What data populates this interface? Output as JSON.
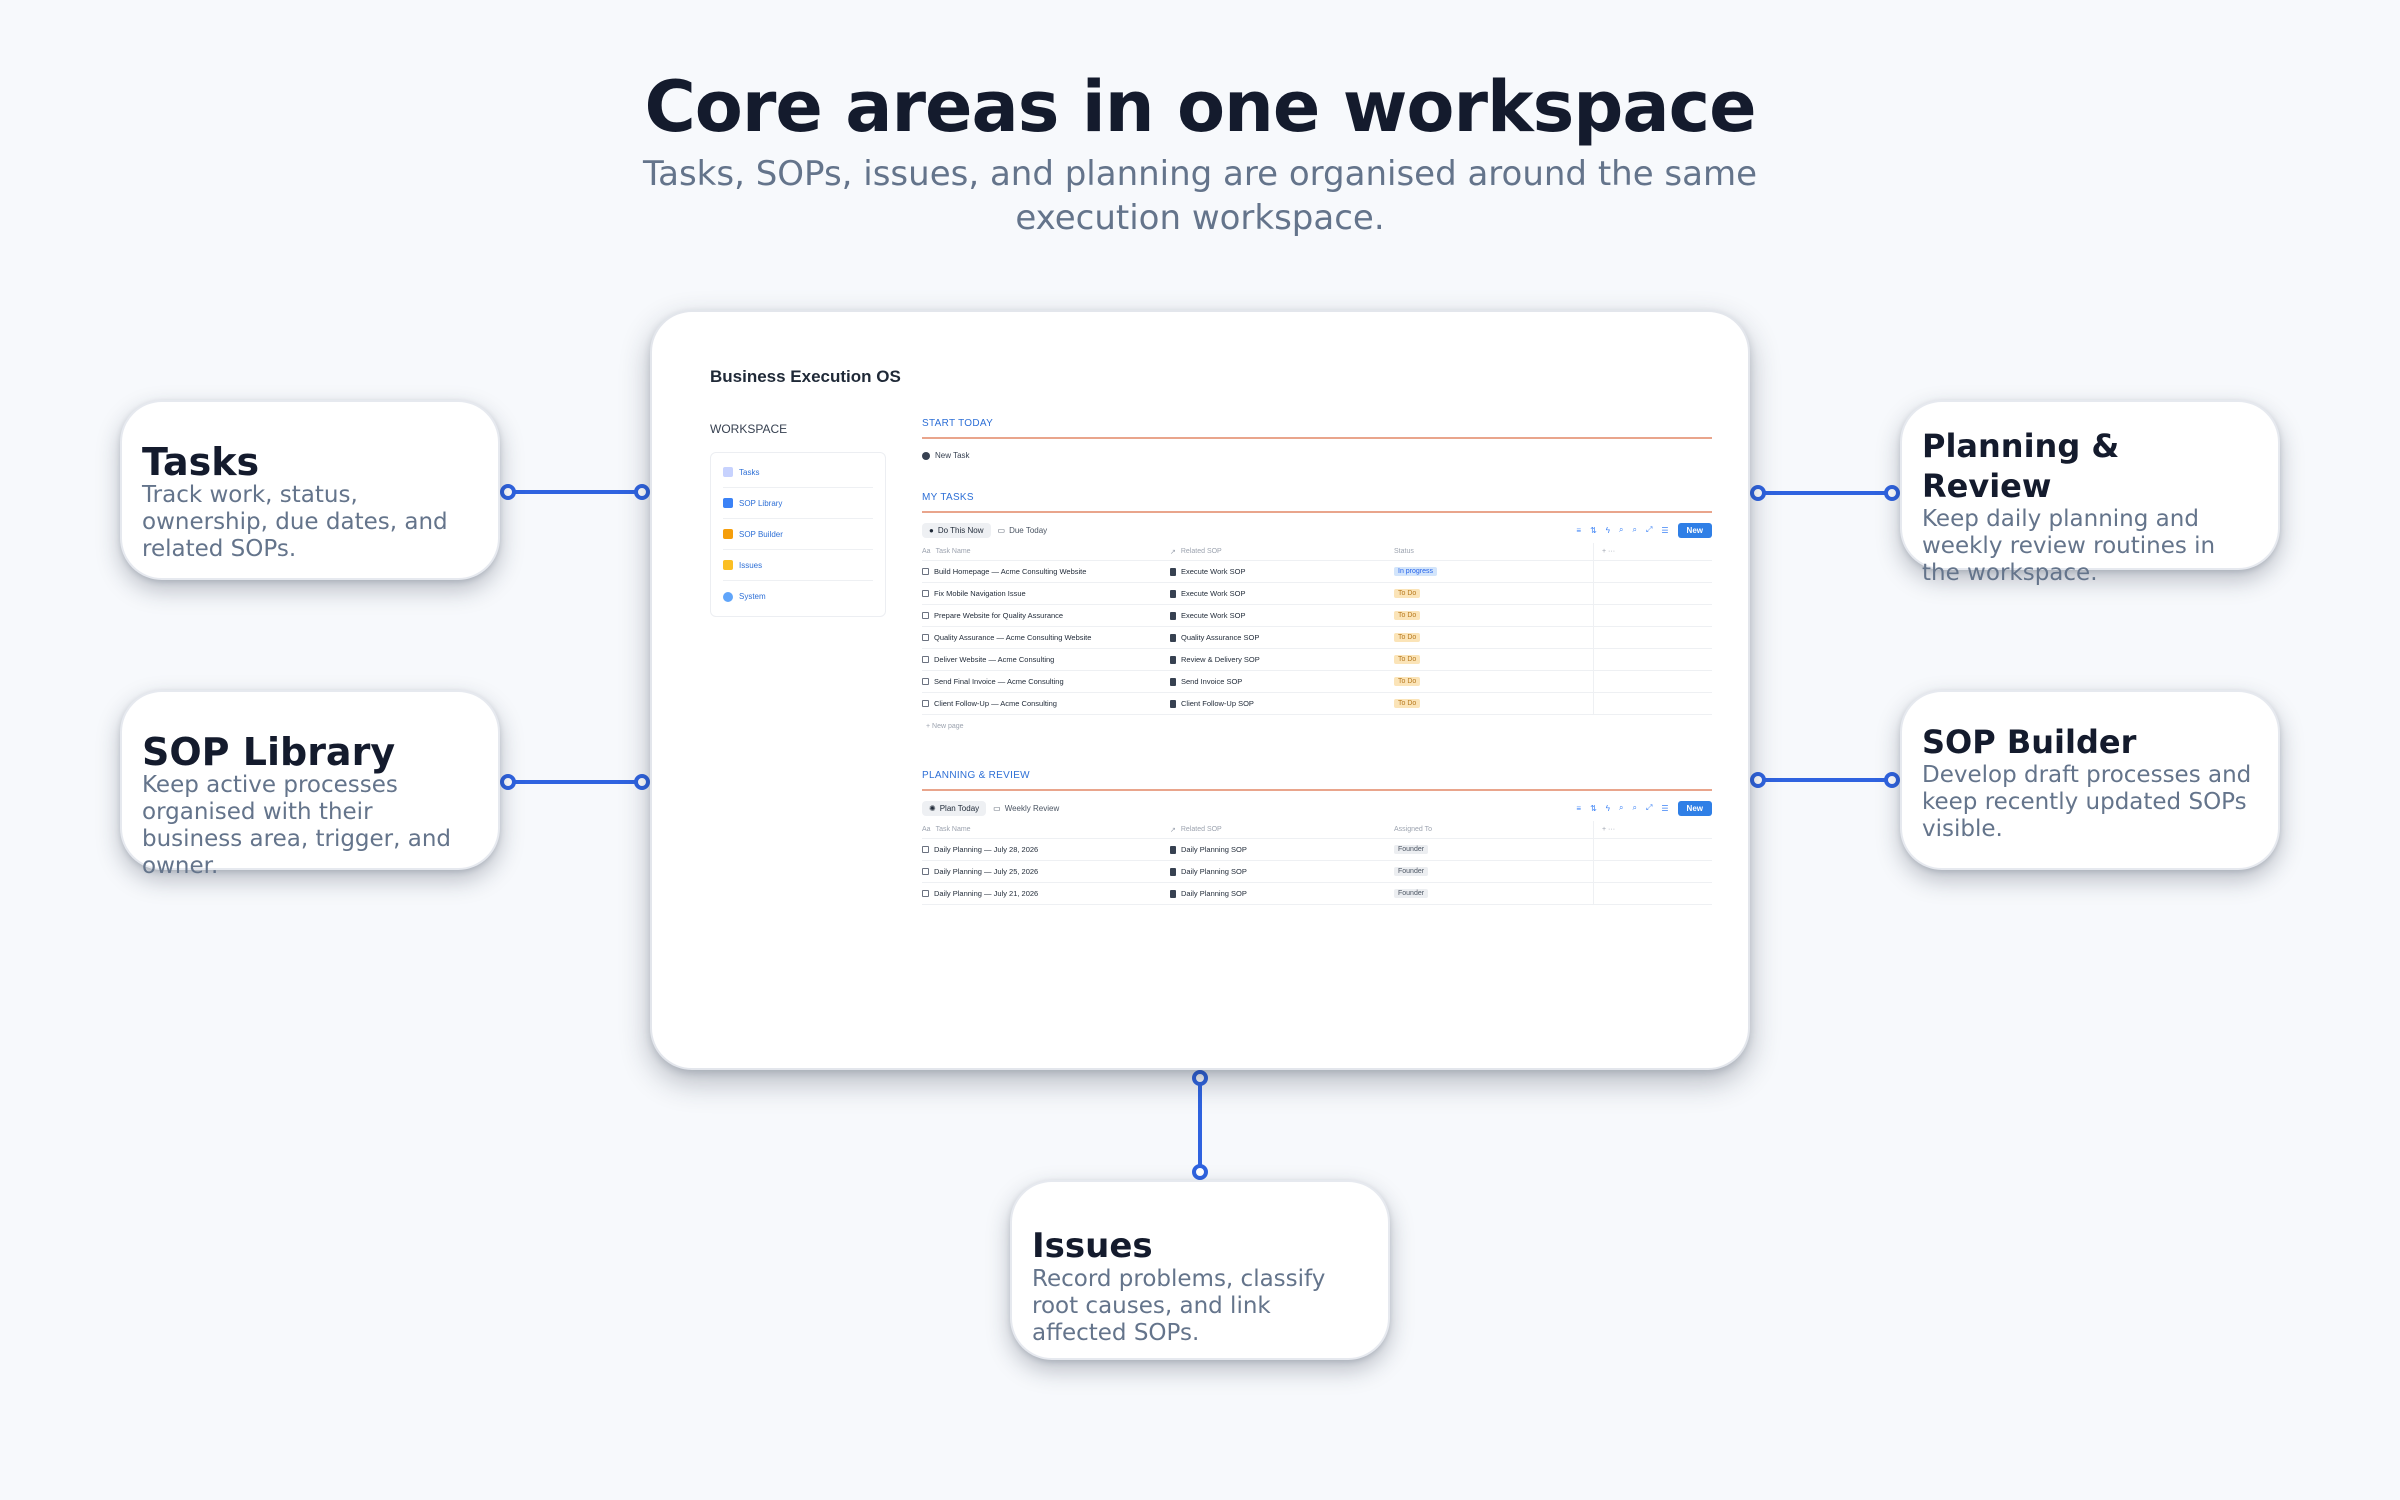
{
  "page": {
    "title": "Core areas in one workspace",
    "subtitle": "Tasks, SOPs, issues, and planning are organised around the same execution workspace."
  },
  "colors": {
    "accent": "#2f63e0",
    "background": "#f7f9fc",
    "title": "#141b2d",
    "muted": "#64748b"
  },
  "cards": {
    "tasks": {
      "title": "Tasks",
      "text": "Track work, status, ownership, due dates, and related SOPs."
    },
    "sop_library": {
      "title": "SOP Library",
      "text": "Keep active processes organised with their business area, trigger, and owner."
    },
    "planning": {
      "title": "Planning & Review",
      "text": "Keep daily planning and weekly review routines in the workspace."
    },
    "sop_builder": {
      "title": "SOP Builder",
      "text": "Develop draft processes and keep recently updated SOPs visible."
    },
    "issues": {
      "title": "Issues",
      "text": "Record problems, classify root causes, and link affected SOPs."
    }
  },
  "app": {
    "title": "Business Execution OS",
    "workspace_label": "WORKSPACE",
    "workspace_items": [
      {
        "label": "Tasks",
        "icon": "task-icon"
      },
      {
        "label": "SOP Library",
        "icon": "book-icon"
      },
      {
        "label": "SOP Builder",
        "icon": "pencil-icon"
      },
      {
        "label": "Issues",
        "icon": "warning-icon"
      },
      {
        "label": "System",
        "icon": "gear-icon"
      }
    ],
    "start_today": {
      "label": "START TODAY",
      "new_task": "New Task"
    },
    "my_tasks": {
      "label": "MY TASKS",
      "tabs": [
        "Do This Now",
        "Due Today"
      ],
      "new_button": "New",
      "columns": [
        "Task Name",
        "Related SOP",
        "Status"
      ],
      "rows": [
        {
          "name": "Build Homepage — Acme Consulting Website",
          "sop": "Execute Work SOP",
          "status": "In progress"
        },
        {
          "name": "Fix Mobile Navigation Issue",
          "sop": "Execute Work SOP",
          "status": "To Do"
        },
        {
          "name": "Prepare Website for Quality Assurance",
          "sop": "Execute Work SOP",
          "status": "To Do"
        },
        {
          "name": "Quality Assurance — Acme Consulting Website",
          "sop": "Quality Assurance SOP",
          "status": "To Do"
        },
        {
          "name": "Deliver Website — Acme Consulting",
          "sop": "Review & Delivery SOP",
          "status": "To Do"
        },
        {
          "name": "Send Final Invoice — Acme Consulting",
          "sop": "Send Invoice SOP",
          "status": "To Do"
        },
        {
          "name": "Client Follow-Up — Acme Consulting",
          "sop": "Client Follow-Up SOP",
          "status": "To Do"
        }
      ],
      "new_page": "New page"
    },
    "planning": {
      "label": "PLANNING & REVIEW",
      "tabs": [
        "Plan Today",
        "Weekly Review"
      ],
      "new_button": "New",
      "columns": [
        "Task Name",
        "Related SOP",
        "Assigned To"
      ],
      "rows": [
        {
          "name": "Daily Planning — July 28, 2026",
          "sop": "Daily Planning SOP",
          "assigned": "Founder"
        },
        {
          "name": "Daily Planning — July 25, 2026",
          "sop": "Daily Planning SOP",
          "assigned": "Founder"
        },
        {
          "name": "Daily Planning — July 21, 2026",
          "sop": "Daily Planning SOP",
          "assigned": "Founder"
        }
      ]
    }
  }
}
